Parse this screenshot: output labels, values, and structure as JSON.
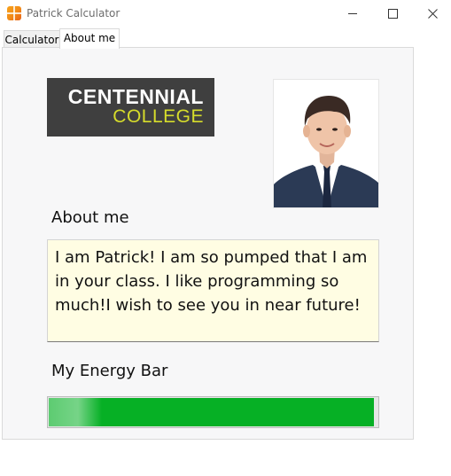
{
  "window": {
    "title": "Patrick Calculator",
    "icon": "calculator-app-icon"
  },
  "tabs": [
    {
      "label": "Calculator",
      "active": false
    },
    {
      "label": "About me",
      "active": true
    }
  ],
  "about_page": {
    "logo": {
      "line1": "CENTENNIAL",
      "line2": "COLLEGE"
    },
    "photo": "profile-photo",
    "about_heading": "About me",
    "about_text": "I am Patrick! I am so pumped that I am in your class. I like programming so much!I wish to see you in near future!",
    "energy_heading": "My Energy Bar",
    "energy_level": 0.99
  },
  "colors": {
    "energy_fill": "#06b025",
    "about_background": "#fffde3",
    "logo_background": "#3f3f3f",
    "logo_accent": "#d6dc2b"
  }
}
